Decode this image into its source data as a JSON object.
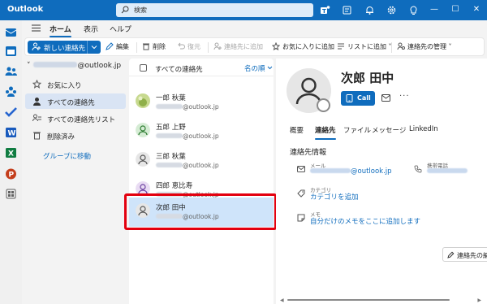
{
  "app": {
    "title": "Outlook"
  },
  "search": {
    "placeholder": "検索"
  },
  "window_controls": {
    "minimize": "—",
    "maximize": "☐",
    "close": "✕"
  },
  "menu": {
    "tabs": [
      "ホーム",
      "表示",
      "ヘルプ"
    ],
    "active": "ホーム"
  },
  "ribbon": {
    "new_contact": "新しい連絡先",
    "edit": "編集",
    "delete": "削除",
    "restore": "復元",
    "add_contacts": "連絡先に追加",
    "add_favorites": "お気に入りに追加",
    "add_to_list": "リストに追加",
    "manage_contacts": "連絡先の管理"
  },
  "folders": {
    "account": "@outlook.jp",
    "items": [
      "お気に入り",
      "すべての連絡先",
      "すべての連絡先リスト",
      "削除済み"
    ],
    "active": "すべての連絡先",
    "go_to_group": "グループに移動"
  },
  "contact_list": {
    "title": "すべての連絡先",
    "sort_label": "名の順",
    "contacts": [
      {
        "name": "一郎 秋葉",
        "email": "@outlook.jp"
      },
      {
        "name": "五郎 上野",
        "email": "@outlook.jp"
      },
      {
        "name": "三郎 秋葉",
        "email": "@outlook.jp"
      },
      {
        "name": "四郎 恵比寿",
        "email": "@outlook.jp"
      },
      {
        "name": "次郎 田中",
        "email": "@outlook.jp"
      }
    ],
    "selected": "次郎 田中"
  },
  "detail": {
    "name": "次郎 田中",
    "call_label": "Call",
    "more_label": "···",
    "tabs": [
      "概要",
      "連絡先",
      "ファイル",
      "メッセージ",
      "LinkedIn"
    ],
    "active_tab": "連絡先",
    "section_title": "連絡先情報",
    "email_label": "メール",
    "email_value": "@outlook.jp",
    "phone_label": "携帯電話",
    "category_label": "カテゴリ",
    "category_value": "カテゴリを追加",
    "memo_label": "メモ",
    "memo_value": "自分だけのメモをここに追加します",
    "edit_contact": "連絡先の編"
  },
  "colors": {
    "brand": "#0f6cbd",
    "highlight": "#e3000f",
    "selected_row": "#cfe4fa"
  },
  "icons": [
    "search-icon",
    "teams-icon",
    "notes-icon",
    "bell-icon",
    "gear-icon",
    "lightbulb-icon",
    "mail-icon",
    "calendar-icon",
    "people-icon",
    "groups-icon",
    "todo-icon",
    "word-icon",
    "excel-icon",
    "powerpoint-icon",
    "apps-icon"
  ]
}
